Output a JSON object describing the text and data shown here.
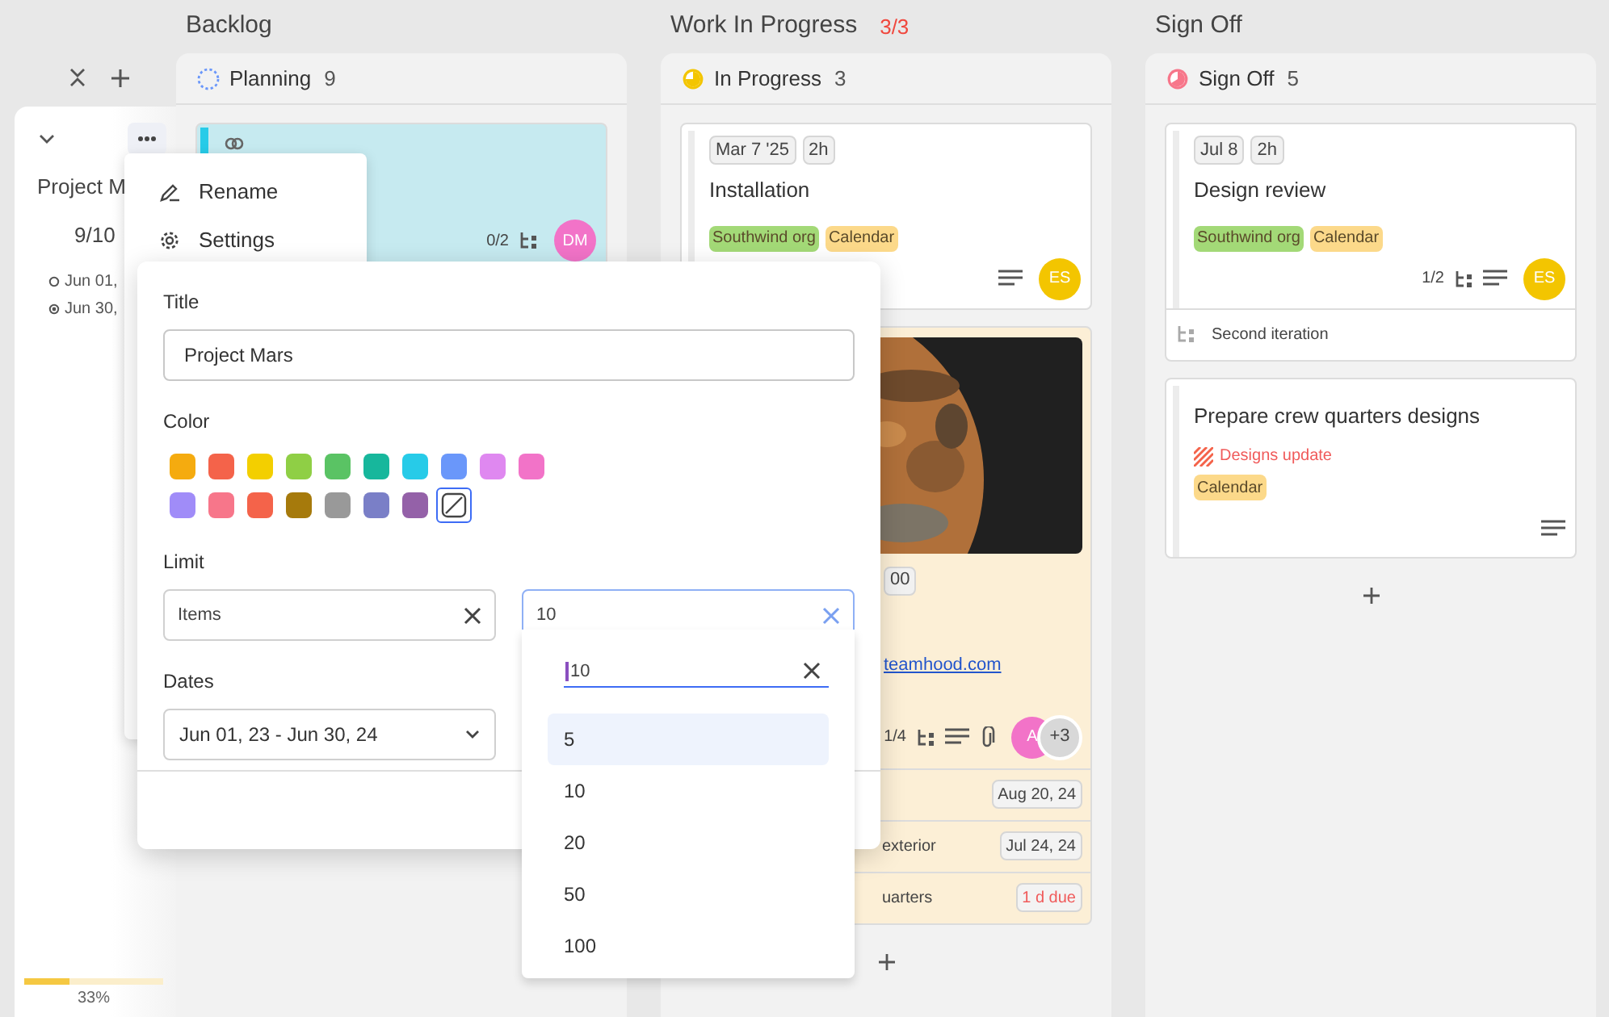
{
  "lanes": [
    {
      "title": "Backlog"
    },
    {
      "title": "Work In Progress",
      "limit": "3/3"
    },
    {
      "title": "Sign Off"
    }
  ],
  "project": {
    "title": "Project M",
    "count": "9/10",
    "start": "Jun 01,",
    "end": "Jun 30,",
    "progress": {
      "level": 0.33,
      "label": "33%"
    }
  },
  "columns": [
    {
      "name": "Planning",
      "count": "9",
      "kind": "planning",
      "cards": [
        {
          "color": "#27cbe8",
          "linked": true,
          "subtasks": "0/2",
          "avatars": [
            {
              "initials": "DM",
              "color": "#f273c8"
            }
          ]
        }
      ]
    },
    {
      "name": "In Progress",
      "count": "3",
      "kind": "progress",
      "cards": [
        {
          "chips": [
            "Mar 7 '25",
            "2h"
          ],
          "title": "Installation",
          "tags": [
            {
              "label": "Southwind org",
              "color": "#a3d977"
            },
            {
              "label": "Calendar",
              "color": "#fcd98a"
            }
          ],
          "description": true,
          "avatars": [
            {
              "initials": "ES",
              "color": "#f3c500"
            }
          ]
        },
        {
          "color": "#fcefd6",
          "picture": true,
          "chips": [
            "00"
          ],
          "link": "teamhood.com",
          "subtasks": "1/4",
          "description": true,
          "attachment": true,
          "avatars": [
            {
              "initials": "A",
              "color": "#f273c8"
            }
          ],
          "more": "+3",
          "rows": [
            {
              "due": "Aug 20, 24",
              "overdue": false
            },
            {
              "title": "exterior",
              "due": "Jul 24, 24",
              "overdue": false
            },
            {
              "title": "uarters",
              "due": "1 d due",
              "overdue": true
            }
          ]
        }
      ]
    },
    {
      "name": "Sign Off",
      "count": "5",
      "kind": "signoff",
      "cards": [
        {
          "chips": [
            "Jul 8",
            "2h"
          ],
          "title": "Design review",
          "tags": [
            {
              "label": "Southwind org",
              "color": "#a3d977"
            },
            {
              "label": "Calendar",
              "color": "#fcd98a"
            }
          ],
          "subtasks": "1/2",
          "description": true,
          "avatars": [
            {
              "initials": "ES",
              "color": "#f3c500"
            }
          ],
          "rows": [
            {
              "title": "Second iteration",
              "subtask": true
            }
          ]
        },
        {
          "title": "Prepare crew quarters designs",
          "risk": {
            "label": "Designs update"
          },
          "tags": [
            {
              "label": "Calendar",
              "color": "#fcd98a"
            }
          ],
          "description": true
        }
      ]
    }
  ],
  "menu": {
    "items": [
      {
        "kind": "rename",
        "label": "Rename"
      },
      {
        "kind": "settings",
        "label": "Settings"
      }
    ]
  },
  "dialog": {
    "title_label": "Title",
    "title_value": "Project Mars",
    "color_label": "Color",
    "swatches": [
      {
        "color": "#f5ab0f",
        "selected": false
      },
      {
        "color": "#f4634a",
        "selected": false
      },
      {
        "color": "#f3cf00",
        "selected": false
      },
      {
        "color": "#8fcf45",
        "selected": false
      },
      {
        "color": "#5ac364",
        "selected": false
      },
      {
        "color": "#17b79c",
        "selected": false
      },
      {
        "color": "#27cbe8",
        "selected": false
      },
      {
        "color": "#6a97fa",
        "selected": false
      },
      {
        "color": "#df88f0",
        "selected": false
      },
      {
        "color": "#f273c8",
        "selected": false
      },
      {
        "color": "#a08cf8",
        "selected": false
      },
      {
        "color": "#f7768a",
        "selected": false
      },
      {
        "color": "#f4634a",
        "selected": false
      },
      {
        "color": "#a67a0c",
        "selected": false
      },
      {
        "color": "#999999",
        "selected": false
      },
      {
        "color": "#7a7fc7",
        "selected": false
      },
      {
        "color": "#9461a8",
        "selected": false
      },
      {
        "kind": "none",
        "selected": true
      }
    ],
    "limit_label": "Limit",
    "limit_type": "Items",
    "limit_value": "10",
    "dates_label": "Dates",
    "dates_value": "Jun 01, 23 - Jun 30, 24"
  },
  "dropdown": {
    "search": "10",
    "options": [
      {
        "label": "5",
        "selected": true
      },
      {
        "label": "10",
        "selected": false
      },
      {
        "label": "20",
        "selected": false
      },
      {
        "label": "50",
        "selected": false
      },
      {
        "label": "100",
        "selected": false
      }
    ]
  }
}
